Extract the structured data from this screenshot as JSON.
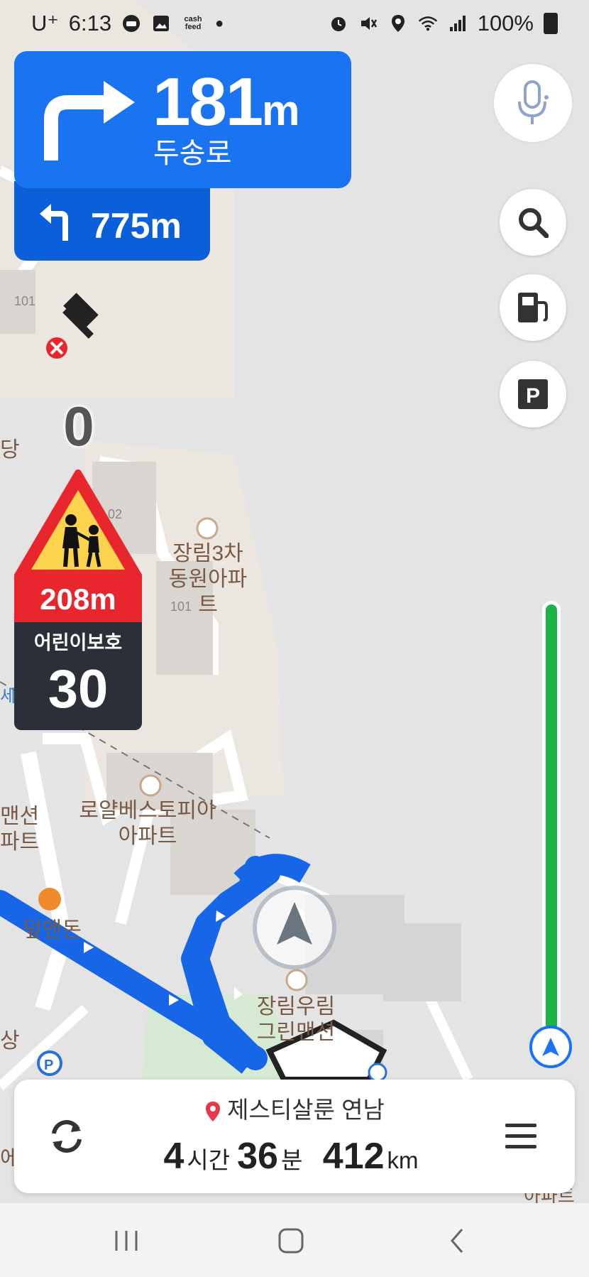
{
  "status_bar": {
    "carrier": "U⁺",
    "time": "6:13",
    "notif_icons": [
      "car-icon",
      "image-icon",
      "cashfeed-icon"
    ],
    "cashfeed_text": "cash feed",
    "system_icons": [
      "alarm-icon",
      "mute-icon",
      "location-icon",
      "wifi-icon",
      "signal-icon"
    ],
    "battery": "100%"
  },
  "navigation": {
    "primary_turn": {
      "direction": "right",
      "distance": "181",
      "unit": "m",
      "road": "두송로"
    },
    "next_turn": {
      "direction": "left",
      "distance": "775m"
    }
  },
  "current_speed": "0",
  "warning": {
    "type": "school-zone",
    "distance": "208m",
    "zone_label": "어린이보호",
    "speed_limit": "30"
  },
  "map_labels": {
    "bldg_101_top": "101",
    "bldg_102": "02",
    "bldg_101_mid": "101",
    "apt_1_line1": "장림3차",
    "apt_1_line2": "동원아파트",
    "apt_2_line1": "로얄베스토피아",
    "apt_2_line2": "아파트",
    "restaurant": "덮앤돈",
    "mansion_line1": "장림우림",
    "mansion_line2": "그린맨션",
    "edge_left_1": "당",
    "edge_left_2": "맨션",
    "edge_left_3": "파트",
    "edge_left_4": "상",
    "edge_left_5": "에",
    "edge_left_6": "세븐",
    "edge_right_1": "아파트"
  },
  "route": {
    "destination": "제스티살룬 연남",
    "hours": "4",
    "hours_unit": "시간",
    "minutes": "36",
    "minutes_unit": "분",
    "distance": "412",
    "distance_unit": "km"
  },
  "progress": {
    "remaining_fraction": 1.0
  },
  "colors": {
    "nav_blue": "#1a73f0",
    "nav_blue_dark": "#0b5fd8",
    "warning_red": "#e8262e",
    "warning_yellow": "#fcd34d",
    "progress_green": "#1db446",
    "route_line": "#1766e8"
  }
}
